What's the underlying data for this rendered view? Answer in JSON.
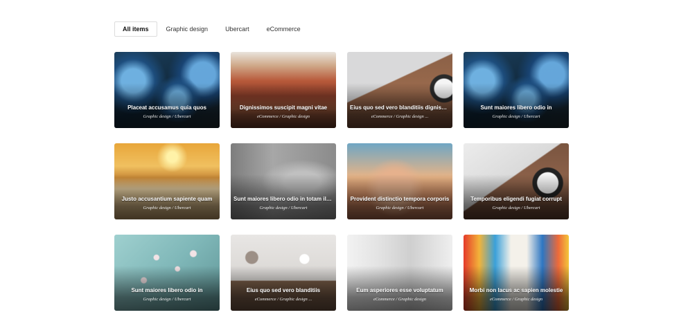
{
  "filters": [
    {
      "label": "All items",
      "active": true
    },
    {
      "label": "Graphic design",
      "active": false
    },
    {
      "label": "Ubercart",
      "active": false
    },
    {
      "label": "eCommerce",
      "active": false
    }
  ],
  "items": [
    {
      "title": "Placeat accusamus quia quos",
      "categories": "Graphic design / Ubercart",
      "image": "light-bulbs-photo"
    },
    {
      "title": "Dignissimos suscipit magni vitae",
      "categories": "eCommerce / Graphic design",
      "image": "canyon-photo"
    },
    {
      "title": "Eius quo sed vero blanditiis dignissimos",
      "categories": "eCommerce / Graphic design ...",
      "image": "laptop-coffee-photo"
    },
    {
      "title": "Sunt maiores libero odio in",
      "categories": "Graphic design / Ubercart",
      "image": "light-bulbs-photo"
    },
    {
      "title": "Justo accusantium sapiente quam",
      "categories": "Graphic design / Ubercart",
      "image": "beach-runner-photo"
    },
    {
      "title": "Sunt maiores libero odio in totam illum",
      "categories": "Graphic design / Ubercart",
      "image": "man-smoking-pipe-photo"
    },
    {
      "title": "Provident distinctio tempora corporis",
      "categories": "Graphic design / Ubercart",
      "image": "woman-sunglasses-photo"
    },
    {
      "title": "Temporibus eligendi fugiat corrupt",
      "categories": "Graphic design / Ubercart",
      "image": "laptop-coffee-photo"
    },
    {
      "title": "Sunt maiores libero odio in",
      "categories": "Graphic design / Ubercart",
      "image": "blossom-branch-photo"
    },
    {
      "title": "Eius quo sed vero blanditiis",
      "categories": "eCommerce / Graphic design ...",
      "image": "desk-topview-photo"
    },
    {
      "title": "Eum asperiores esse voluptatum",
      "categories": "eCommerce / Graphic design",
      "image": "office-workers-photo"
    },
    {
      "title": "Morbi non lacus ac sapien molestie",
      "categories": "eCommerce / Graphic design",
      "image": "graffiti-hallway-photo"
    }
  ]
}
